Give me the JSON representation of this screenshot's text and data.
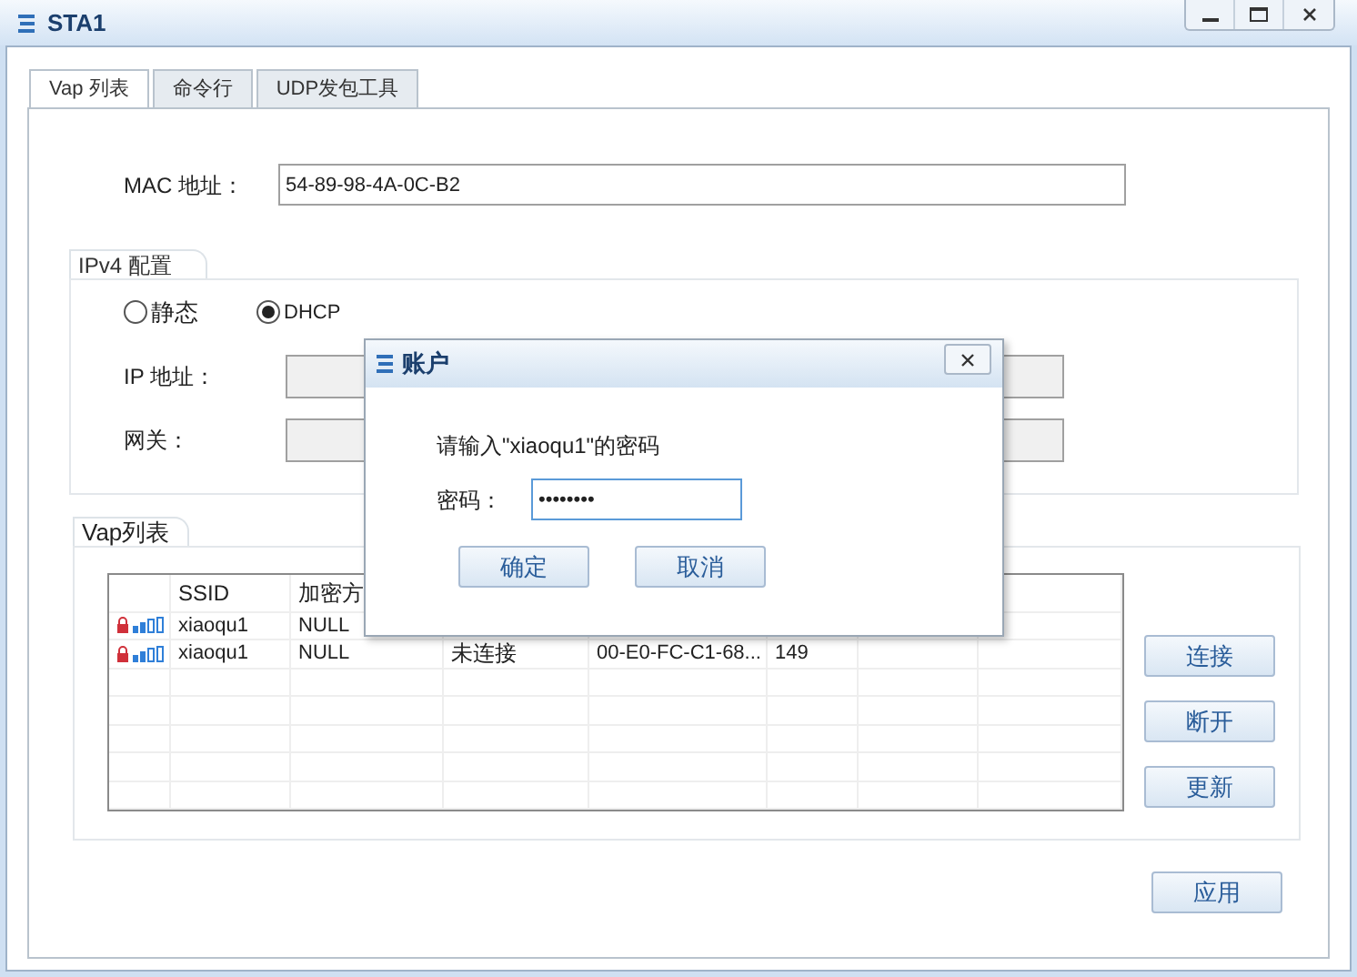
{
  "window": {
    "title": "STA1"
  },
  "tabs": [
    {
      "label": "Vap 列表",
      "selected": true
    },
    {
      "label": "命令行",
      "selected": false
    },
    {
      "label": "UDP发包工具",
      "selected": false
    }
  ],
  "mac": {
    "label": "MAC 地址：",
    "value": "54-89-98-4A-0C-B2"
  },
  "ipv4": {
    "title": "IPv4 配置",
    "modes": [
      {
        "label": "静态",
        "selected": false
      },
      {
        "label": "DHCP",
        "selected": true
      }
    ],
    "ip_label": "IP 地址：",
    "gateway_label": "网关："
  },
  "vap": {
    "title": "Vap列表",
    "columns": [
      "SSID",
      "加密方"
    ],
    "rows": [
      {
        "locked": true,
        "cells": [
          "xiaoqu1",
          "NULL"
        ]
      },
      {
        "locked": true,
        "cells": [
          "xiaoqu1",
          "NULL",
          "未连接",
          "00-E0-FC-C1-68...",
          "149"
        ]
      }
    ],
    "buttons": [
      "连接",
      "断开",
      "更新"
    ]
  },
  "apply_button": "应用",
  "dialog": {
    "title": "账户",
    "prompt": "请输入\"xiaoqu1\"的密码",
    "password_label": "密码：",
    "password_value": "••••••••",
    "buttons": [
      "确定",
      "取消"
    ]
  }
}
